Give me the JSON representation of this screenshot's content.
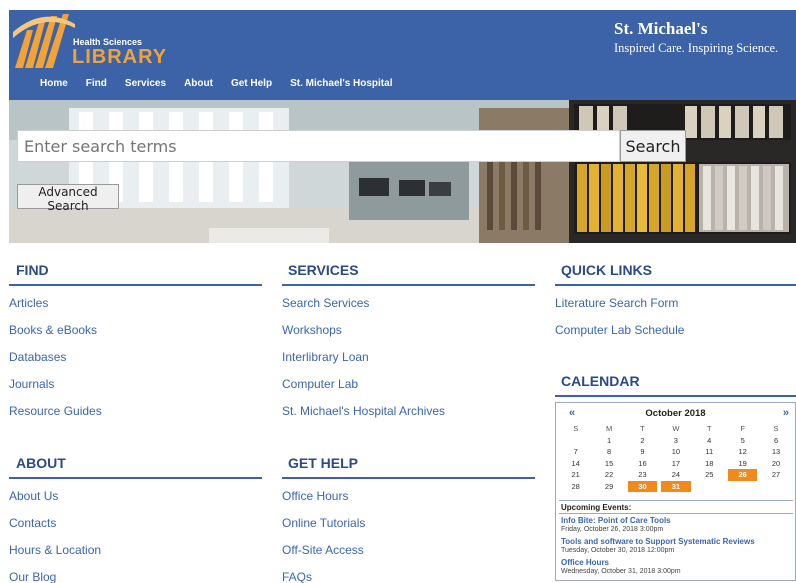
{
  "header": {
    "logo_small": "Health Sciences",
    "logo_large": "LIBRARY",
    "brand_name": "St. Michael's",
    "brand_tagline": "Inspired Care. Inspiring Science.",
    "nav": [
      "Home",
      "Find",
      "Services",
      "About",
      "Get Help",
      "St. Michael's Hospital"
    ]
  },
  "search": {
    "placeholder": "Enter search terms",
    "button_label": "Search",
    "advanced_label": "Advanced Search"
  },
  "find": {
    "heading": "FIND",
    "links": [
      "Articles",
      "Books & eBooks",
      "Databases",
      "Journals",
      "Resource Guides"
    ]
  },
  "services": {
    "heading": "SERVICES",
    "links": [
      "Search Services",
      "Workshops",
      "Interlibrary Loan",
      "Computer Lab",
      "St. Michael's Hospital Archives"
    ]
  },
  "quick_links": {
    "heading": "QUICK LINKS",
    "links": [
      "Literature Search Form",
      "Computer Lab Schedule"
    ]
  },
  "about": {
    "heading": "ABOUT",
    "links": [
      "About Us",
      "Contacts",
      "Hours & Location",
      "Our Blog"
    ]
  },
  "get_help": {
    "heading": "GET HELP",
    "links": [
      "Office Hours",
      "Online Tutorials",
      "Off-Site Access",
      "FAQs"
    ]
  },
  "calendar": {
    "heading": "CALENDAR",
    "prev": "«",
    "next": "»",
    "month": "October 2018",
    "weekdays": [
      "S",
      "M",
      "T",
      "W",
      "T",
      "F",
      "S"
    ],
    "weeks": [
      [
        "",
        "1",
        "2",
        "3",
        "4",
        "5",
        "6"
      ],
      [
        "7",
        "8",
        "9",
        "10",
        "11",
        "12",
        "13"
      ],
      [
        "14",
        "15",
        "16",
        "17",
        "18",
        "19",
        "20"
      ],
      [
        "21",
        "22",
        "23",
        "24",
        "25",
        "26",
        "27"
      ],
      [
        "28",
        "29",
        "30",
        "31",
        "",
        "",
        ""
      ]
    ],
    "highlighted_days": [
      "26",
      "30",
      "31"
    ],
    "highlight_color": "#f08a1c",
    "upcoming_title": "Upcoming Events:",
    "events": [
      {
        "title": "Info Bite: Point of Care Tools",
        "date": "Friday, October 26, 2018 3:00pm"
      },
      {
        "title": "Tools and software to Support Systematic Reviews",
        "date": "Tuesday, October 30, 2018 12:00pm"
      },
      {
        "title": "Office Hours",
        "date": "Wednesday, October 31, 2018 3:00pm"
      }
    ]
  },
  "colors": {
    "header_blue": "#3c63a8",
    "logo_orange": "#f3a236",
    "link_blue": "#3a66b0",
    "heading_navy": "#2b4a8a"
  }
}
